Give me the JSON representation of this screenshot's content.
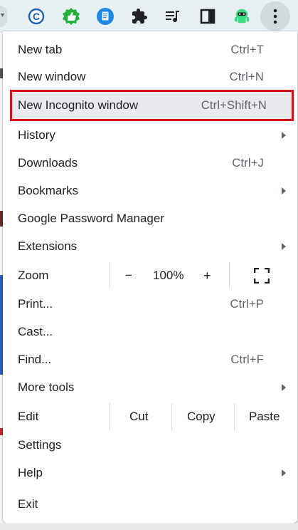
{
  "colors": {
    "highlight_border": "#d3131a",
    "menu_background": "#ffffff",
    "shortcut_text": "#5f6368",
    "toolbar_background": "#e8f0f3"
  },
  "toolbar": {
    "icons": [
      "copyright-c-icon",
      "thumbs-up-extension-icon",
      "document-extension-icon",
      "puzzle-extensions-icon",
      "media-queue-icon",
      "side-panel-icon",
      "android-extension-icon",
      "kebab-menu-icon"
    ]
  },
  "menu": {
    "items": {
      "new_tab": {
        "label": "New tab",
        "shortcut": "Ctrl+T"
      },
      "new_window": {
        "label": "New window",
        "shortcut": "Ctrl+N"
      },
      "new_incognito": {
        "label": "New Incognito window",
        "shortcut": "Ctrl+Shift+N"
      },
      "history": {
        "label": "History"
      },
      "downloads": {
        "label": "Downloads",
        "shortcut": "Ctrl+J"
      },
      "bookmarks": {
        "label": "Bookmarks"
      },
      "password_manager": {
        "label": "Google Password Manager"
      },
      "extensions": {
        "label": "Extensions"
      },
      "zoom": {
        "label": "Zoom",
        "minus": "−",
        "value": "100%",
        "plus": "+"
      },
      "print": {
        "label": "Print...",
        "shortcut": "Ctrl+P"
      },
      "cast": {
        "label": "Cast..."
      },
      "find": {
        "label": "Find...",
        "shortcut": "Ctrl+F"
      },
      "more_tools": {
        "label": "More tools"
      },
      "edit": {
        "label": "Edit",
        "cut": "Cut",
        "copy": "Copy",
        "paste": "Paste"
      },
      "settings": {
        "label": "Settings"
      },
      "help": {
        "label": "Help"
      },
      "exit": {
        "label": "Exit"
      }
    }
  }
}
